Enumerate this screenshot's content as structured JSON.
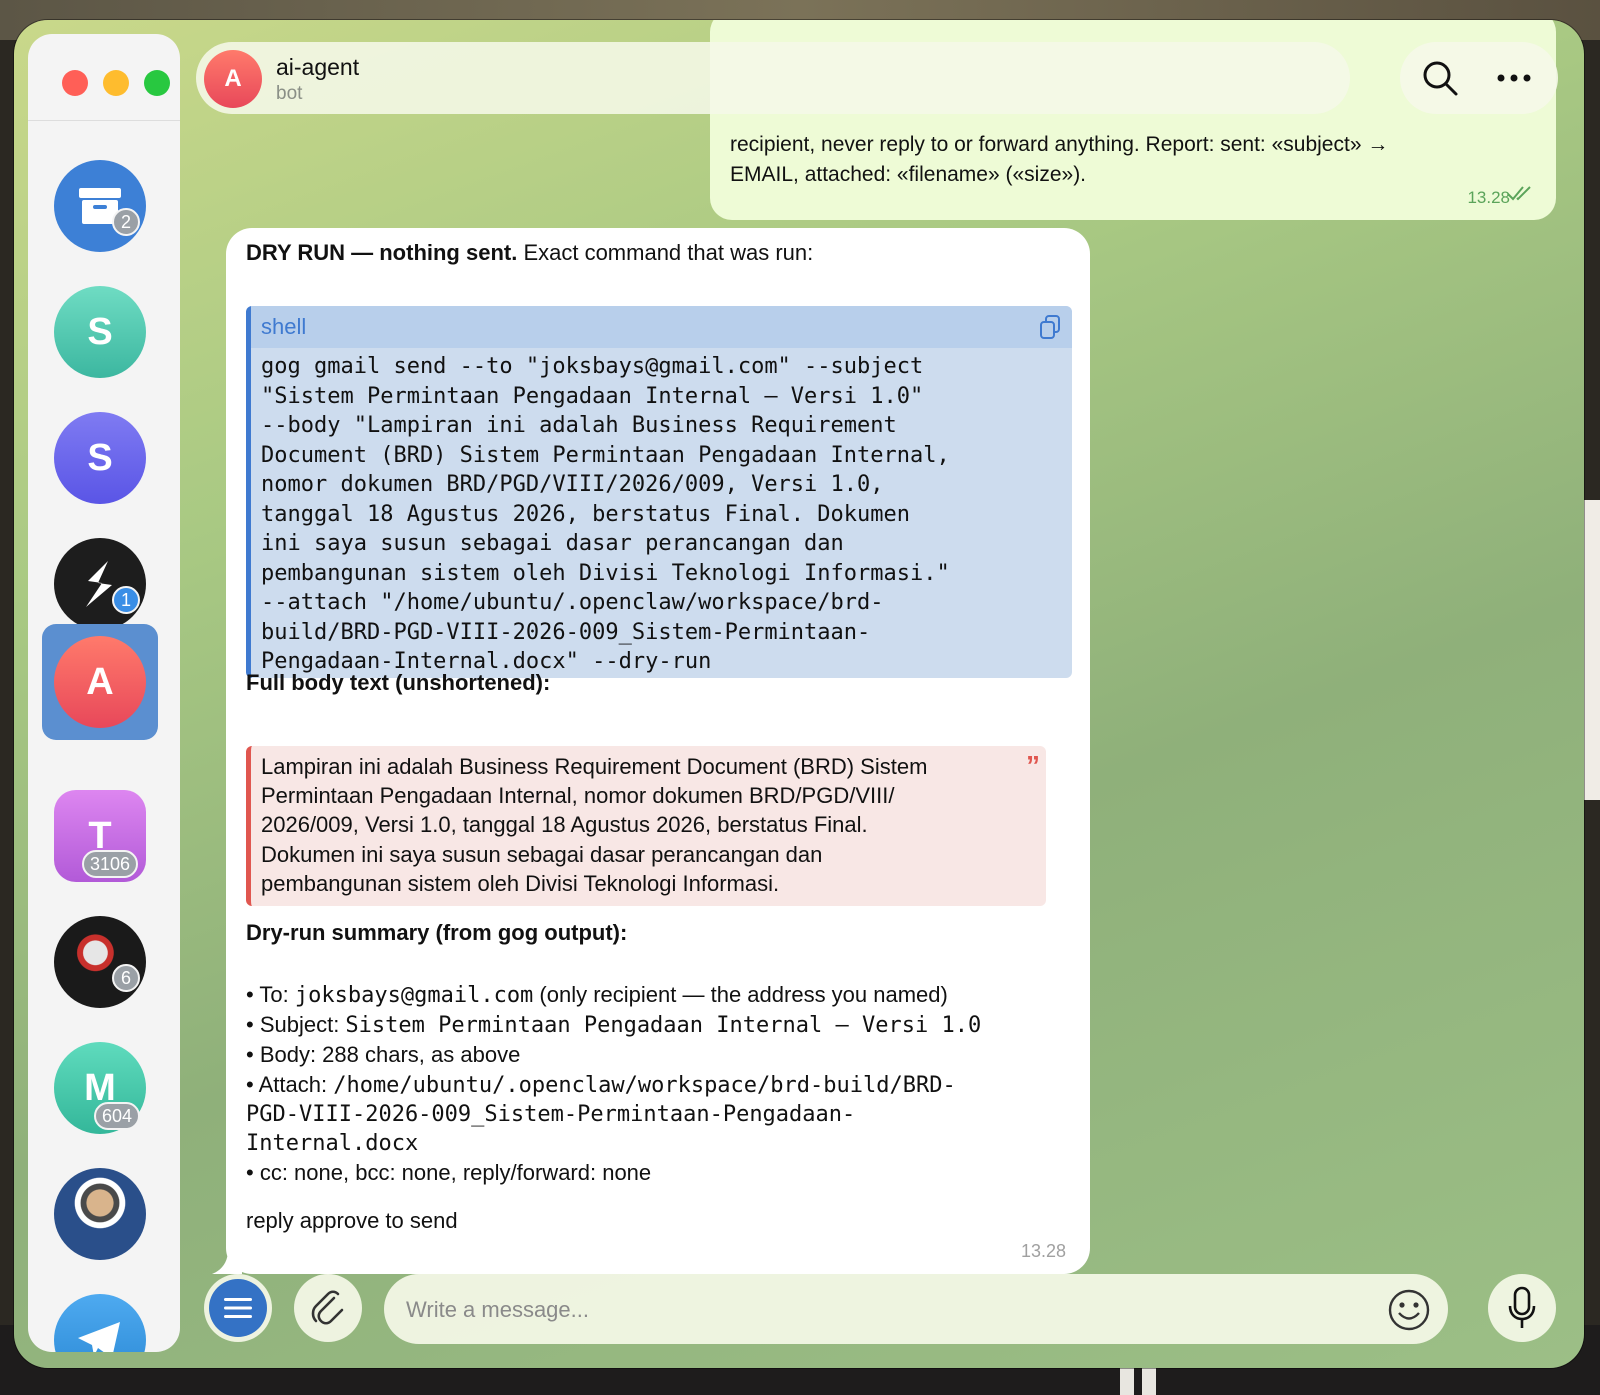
{
  "chat": {
    "title": "ai-agent",
    "subtitle": "bot",
    "avatar_letter": "A"
  },
  "sidebar": {
    "chats": [
      {
        "name": "archive-folder",
        "badge": "2",
        "color": "#3d80d6"
      },
      {
        "letter": "S",
        "color": "#4fc9b0"
      },
      {
        "letter": "S",
        "color": "#6a63ec"
      },
      {
        "name": "dark-logo-chat",
        "badge": "1",
        "color": "#1d1d1d"
      },
      {
        "letter": "A",
        "color": "#ef5a55",
        "active": true
      },
      {
        "letter": "T",
        "badge": "3106",
        "color": "#c46be0"
      },
      {
        "name": "photo-chat-fist",
        "badge": "6",
        "color": "#1a1a1a"
      },
      {
        "letter": "M",
        "badge": "604",
        "color": "#3dc6a6"
      },
      {
        "name": "photo-chat-person",
        "color": "#3d6fb0"
      },
      {
        "name": "telegram-app",
        "color": "#3a94d8"
      }
    ]
  },
  "outgoing": {
    "visible_lines": [
      "recipient, never reply to or forward anything. Report: sent: «subject» →",
      "EMAIL, attached: «filename» («size»)."
    ],
    "time": "13.28"
  },
  "incoming": {
    "intro_bold": "DRY RUN — nothing sent.",
    "intro_rest": " Exact command that was run:",
    "code_lang": "shell",
    "code_lines": [
      "gog gmail send --to \"joksbays@gmail.com\" --subject",
      "\"Sistem Permintaan Pengadaan Internal – Versi 1.0\"",
      "--body \"Lampiran ini adalah Business Requirement",
      "Document (BRD) Sistem Permintaan Pengadaan Internal,",
      "nomor dokumen BRD/PGD/VIII/2026/009, Versi 1.0,",
      "tanggal 18 Agustus 2026, berstatus Final. Dokumen",
      "ini saya susun sebagai dasar perancangan dan",
      "pembangunan sistem oleh Divisi Teknologi Informasi.\"",
      "--attach \"/home/ubuntu/.openclaw/workspace/brd-",
      "build/BRD-PGD-VIII-2026-009_Sistem-Permintaan-",
      "Pengadaan-Internal.docx\" --dry-run"
    ],
    "body_heading": "Full body text (unshortened):",
    "quote_lines": [
      "Lampiran ini adalah Business Requirement Document (BRD) Sistem",
      "Permintaan Pengadaan Internal, nomor dokumen BRD/PGD/VIII/",
      "2026/009, Versi 1.0, tanggal 18 Agustus 2026, berstatus Final.",
      "Dokumen ini saya susun sebagai dasar perancangan dan",
      "pembangunan sistem oleh Divisi Teknologi Informasi."
    ],
    "summary_heading": "Dry-run summary (from gog output):",
    "summary": {
      "to_label": "• To: ",
      "to_value": "joksbays@gmail.com",
      "to_note": " (only recipient — the address you named)",
      "subject_label": "• Subject: ",
      "subject_value": "Sistem Permintaan Pengadaan Internal – Versi 1.0",
      "body_line": "• Body: 288 chars, as above",
      "attach_label": "• Attach: ",
      "attach_value_1": "/home/ubuntu/.openclaw/workspace/brd-build/BRD-",
      "attach_value_2": "PGD-VIII-2026-009_Sistem-Permintaan-Pengadaan-",
      "attach_value_3": "Internal.docx",
      "cc_line": "• cc: none, bcc: none, reply/forward: none"
    },
    "footer": "reply approve to send",
    "time": "13.28"
  },
  "composer": {
    "placeholder": "Write a message..."
  }
}
